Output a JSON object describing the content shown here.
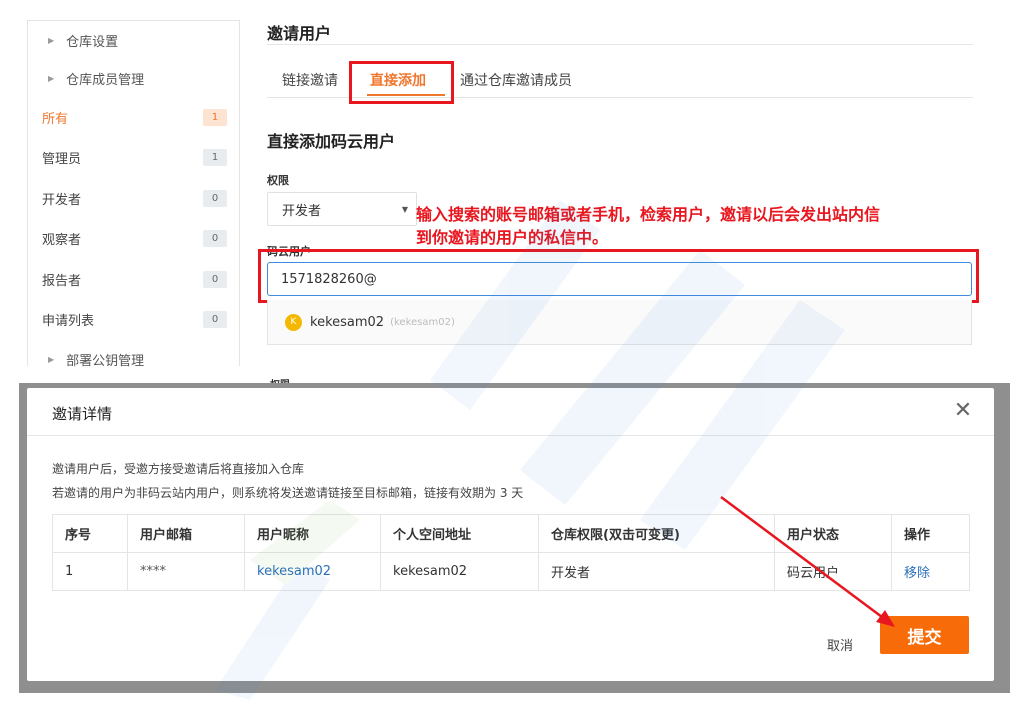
{
  "sidebar": {
    "groups": [
      {
        "label": "仓库设置"
      },
      {
        "label": "仓库成员管理"
      },
      {
        "label": "部署公钥管理"
      }
    ],
    "items": [
      {
        "label": "所有",
        "count": "1"
      },
      {
        "label": "管理员",
        "count": "1"
      },
      {
        "label": "开发者",
        "count": "0"
      },
      {
        "label": "观察者",
        "count": "0"
      },
      {
        "label": "报告者",
        "count": "0"
      },
      {
        "label": "申请列表",
        "count": "0"
      }
    ]
  },
  "page": {
    "title": "邀请用户",
    "tabs": [
      {
        "label": "链接邀请"
      },
      {
        "label": "直接添加"
      },
      {
        "label": "通过仓库邀请成员"
      }
    ],
    "section_title": "直接添加码云用户",
    "permission_label": "权限",
    "permission_value": "开发者",
    "user_label": "码云用户",
    "user_input_value": "1571828260@",
    "suggestion": {
      "avatar_letter": "K",
      "name": "kekesam02",
      "sub": "(kekesam02)"
    },
    "cut_label": "权限"
  },
  "annotation": {
    "line1": "输入搜索的账号邮箱或者手机，检索用户，邀请以后会发出站内信",
    "line2": "到你邀请的用户的私信中。"
  },
  "modal": {
    "title": "邀请详情",
    "close_glyph": "✕",
    "note1": "邀请用户后，受邀方接受邀请后将直接加入仓库",
    "note2": "若邀请的用户为非码云站内用户，则系统将发送邀请链接至目标邮箱，链接有效期为 3 天",
    "columns": [
      "序号",
      "用户邮箱",
      "用户昵称",
      "个人空间地址",
      "仓库权限(双击可变更)",
      "用户状态",
      "操作"
    ],
    "rows": [
      [
        "1",
        "****",
        "kekesam02",
        "kekesam02",
        "开发者",
        "码云用户",
        "移除"
      ]
    ],
    "cancel_label": "取消",
    "submit_label": "提交"
  },
  "colors": {
    "accent": "#f0772e",
    "highlight_red": "#e8161f",
    "link_blue": "#2a6ebb",
    "submit_orange": "#f76c08"
  }
}
